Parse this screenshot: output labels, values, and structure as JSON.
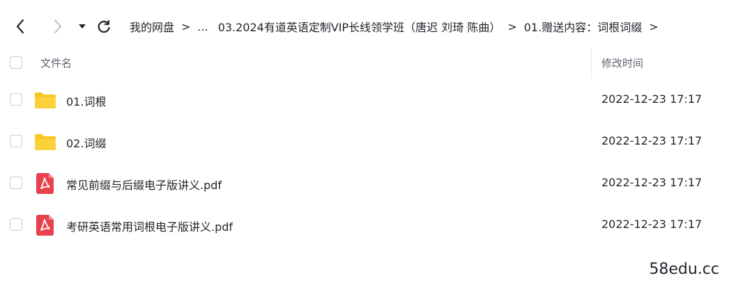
{
  "toolbar": {
    "back_icon": "chevron-left-icon",
    "forward_icon": "chevron-right-icon",
    "dropdown_icon": "caret-down-icon",
    "refresh_icon": "refresh-icon"
  },
  "breadcrumb": {
    "root": "我的网盘",
    "separator": ">",
    "ellipsis": "...",
    "middle": "03.2024有道英语定制VIP长线领学班（唐迟 刘琦 陈曲）",
    "current": "01.赠送内容：词根词缀"
  },
  "header": {
    "name_label": "文件名",
    "time_label": "修改时间"
  },
  "files": [
    {
      "name": "01.词根",
      "time": "2022-12-23 17:17",
      "type": "folder"
    },
    {
      "name": "02.词缀",
      "time": "2022-12-23 17:17",
      "type": "folder"
    },
    {
      "name": "常见前缀与后缀电子版讲义.pdf",
      "time": "2022-12-23 17:17",
      "type": "pdf"
    },
    {
      "name": "考研英语常用词根电子版讲义.pdf",
      "time": "2022-12-23 17:17",
      "type": "pdf"
    }
  ],
  "colors": {
    "folder": "#f9c623",
    "pdf": "#e8424f",
    "text": "#1f2329",
    "muted": "#5c6370"
  },
  "watermark": "58edu.cc"
}
